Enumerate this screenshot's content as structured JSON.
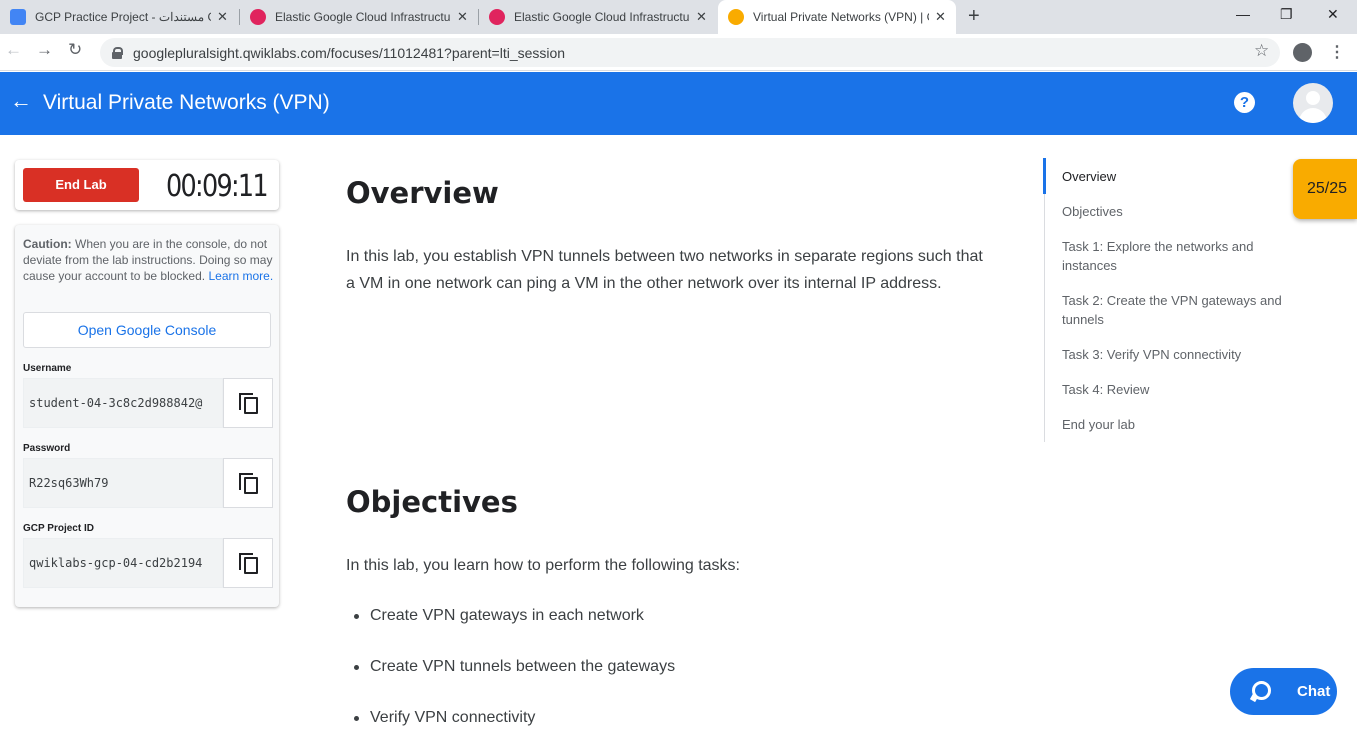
{
  "browser": {
    "tabs": [
      {
        "label": "GCP Practice Project - مستندات G",
        "close": "✕",
        "favicon_color": "#4285f4"
      },
      {
        "label": "Elastic Google Cloud Infrastructu",
        "close": "✕",
        "favicon_color": "#e0245e"
      },
      {
        "label": "Elastic Google Cloud Infrastructu",
        "close": "✕",
        "favicon_color": "#e0245e"
      },
      {
        "label": "Virtual Private Networks (VPN) | G",
        "close": "✕",
        "favicon_color": "#f9ab00"
      }
    ],
    "new_tab": "+",
    "window_controls": {
      "minimize": "—",
      "maximize": "❐",
      "close": "✕"
    },
    "nav": {
      "back": "←",
      "forward": "→",
      "reload": "↻"
    },
    "url": "googlepluralsight.qwiklabs.com/focuses/11012481?parent=lti_session",
    "star": "☆",
    "menu": "⋮"
  },
  "header": {
    "back": "←",
    "title": "Virtual Private Networks (VPN)",
    "help": "?"
  },
  "lab_panel": {
    "end_lab_label": "End Lab",
    "timer": "00:09:11",
    "caution_bold": "Caution:",
    "caution_text": " When you are in the console, do not deviate from the lab instructions. Doing so may cause your account to be blocked.",
    "learn_more": "Learn more.",
    "open_console_label": "Open Google Console",
    "fields": [
      {
        "label": "Username",
        "value": "student-04-3c8c2d988842@"
      },
      {
        "label": "Password",
        "value": "R22sq63Wh79"
      },
      {
        "label": "GCP Project ID",
        "value": "qwiklabs-gcp-04-cd2b2194"
      }
    ]
  },
  "content": {
    "overview_heading": "Overview",
    "overview_text": "In this lab, you establish VPN tunnels between two networks in separate regions such that a VM in one network can ping a VM in the other network over its internal IP address.",
    "objectives_heading": "Objectives",
    "objectives_intro": "In this lab, you learn how to perform the following tasks:",
    "objectives": [
      "Create VPN gateways in each network",
      "Create VPN tunnels between the gateways",
      "Verify VPN connectivity"
    ]
  },
  "toc": {
    "items": [
      "Overview",
      "Objectives",
      "Task 1: Explore the networks and instances",
      "Task 2: Create the VPN gateways and tunnels",
      "Task 3: Verify VPN connectivity",
      "Task 4: Review",
      "End your lab"
    ],
    "active_index": 0
  },
  "score": "25/25",
  "chat_label": "Chat",
  "colors": {
    "header_blue": "#1a73e8",
    "end_lab_red": "#d93025",
    "score_yellow": "#f9ab00"
  }
}
